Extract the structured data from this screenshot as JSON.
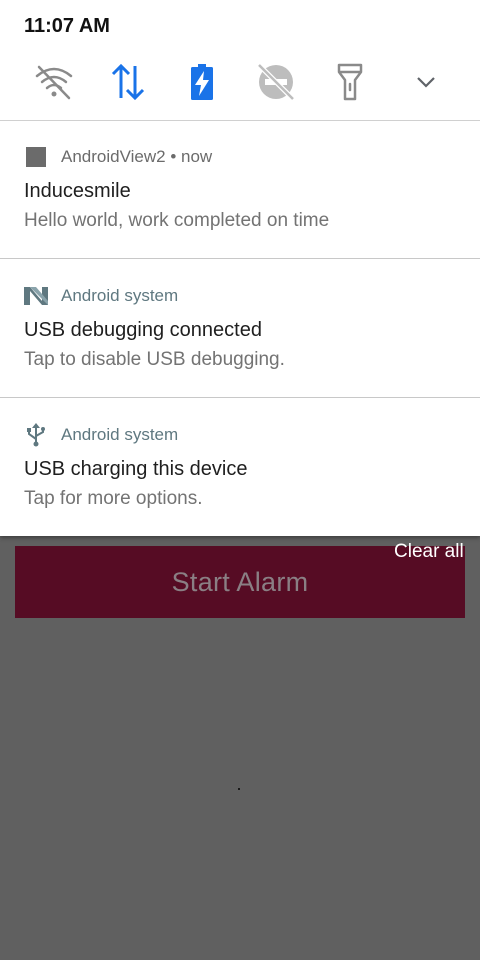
{
  "status_bar": {
    "time": "11:07 AM"
  },
  "quick_settings": [
    {
      "name": "wifi-off-icon"
    },
    {
      "name": "mobile-data-icon"
    },
    {
      "name": "battery-saver-icon"
    },
    {
      "name": "do-not-disturb-off-icon"
    },
    {
      "name": "flashlight-icon"
    },
    {
      "name": "expand-chevron-icon"
    }
  ],
  "colors": {
    "accent": "#1a73e8",
    "inactive_icon": "#8a8a8a",
    "app_button": "#560c24"
  },
  "notifications": [
    {
      "app": "AndroidView2 • now",
      "title": "Inducesmile",
      "text": "Hello world, work completed on time",
      "icon": "square-app-icon"
    },
    {
      "app": "Android system",
      "title": "USB debugging connected",
      "text": "Tap to disable USB debugging.",
      "icon": "android-n-icon"
    },
    {
      "app": "Android system",
      "title": "USB charging this device",
      "text": "Tap for more options.",
      "icon": "usb-icon"
    }
  ],
  "clear_all": "Clear all",
  "app": {
    "button_label": "Start Alarm"
  }
}
